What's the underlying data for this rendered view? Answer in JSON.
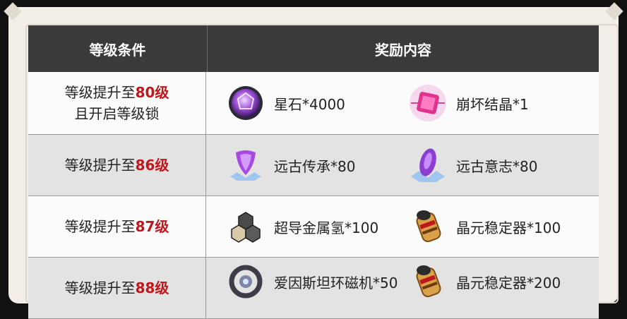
{
  "header": {
    "condition": "等级条件",
    "reward": "奖励内容"
  },
  "rows": [
    {
      "cond_prefix": "等级提升至",
      "cond_level": "80级",
      "cond_suffix": "且开启等级锁",
      "reward1": {
        "name": "星石*4000",
        "icon": "star-stone-icon"
      },
      "reward2": {
        "name": "崩坏结晶*1",
        "icon": "honkai-crystal-icon"
      }
    },
    {
      "cond_prefix": "等级提升至",
      "cond_level": "86级",
      "reward1": {
        "name": "远古传承*80",
        "icon": "ancient-legacy-icon"
      },
      "reward2": {
        "name": "远古意志*80",
        "icon": "ancient-will-icon"
      }
    },
    {
      "cond_prefix": "等级提升至",
      "cond_level": "87级",
      "reward1": {
        "name": "超导金属氢*100",
        "icon": "metallic-hydrogen-icon"
      },
      "reward2": {
        "name": "晶元稳定器*100",
        "icon": "crystal-stabilizer-icon"
      }
    },
    {
      "cond_prefix": "等级提升至",
      "cond_level": "88级",
      "reward1": {
        "name": "爱因斯坦环磁机*50",
        "icon": "einstein-torus-icon"
      },
      "reward2": {
        "name": "晶元稳定器*200",
        "icon": "crystal-stabilizer-icon"
      }
    }
  ],
  "colors": {
    "header_bg": "#3a3a3a",
    "level_red": "#c0171c",
    "row_grey": "#e3e3e3"
  }
}
